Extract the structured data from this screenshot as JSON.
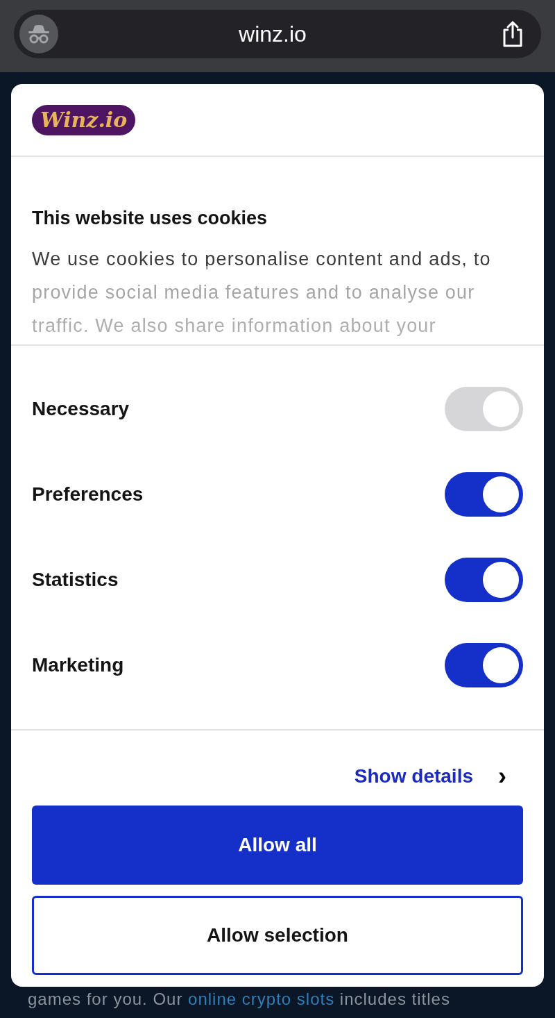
{
  "browser": {
    "url": "winz.io"
  },
  "dialog": {
    "logo": "Winz.io",
    "title": "This website uses cookies",
    "description": "We use cookies to personalise content and ads, to provide social media features and to analyse our traffic. We also share information about your",
    "toggles": [
      {
        "label": "Necessary",
        "on": true,
        "disabled": true
      },
      {
        "label": "Preferences",
        "on": true,
        "disabled": false
      },
      {
        "label": "Statistics",
        "on": true,
        "disabled": false
      },
      {
        "label": "Marketing",
        "on": true,
        "disabled": false
      }
    ],
    "details_link": "Show details",
    "details_chevron": "›",
    "buttons": [
      {
        "label": "Allow all",
        "kind": "primary"
      },
      {
        "label": "Allow selection",
        "kind": "outline"
      }
    ]
  },
  "page_text": "games for you. Our *online crypto slots* includes titles"
}
